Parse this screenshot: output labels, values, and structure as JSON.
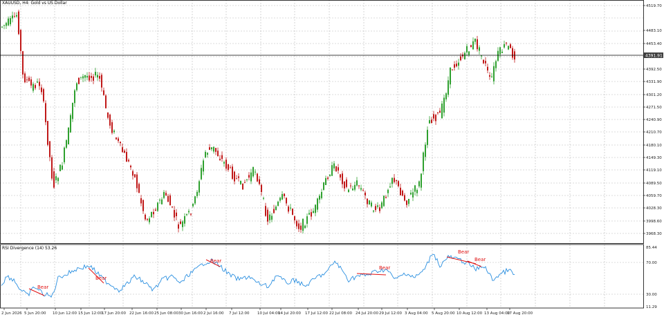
{
  "window": {
    "title": "XAUUSD, H4: Gold vs US Dollar",
    "indicator_title": "RSI Divergence (14) 53.26"
  },
  "price_axis": {
    "labels": [
      "4519.70",
      "4483.10",
      "4453.40",
      "4422.10",
      "4392.50",
      "4331.90",
      "4301.20",
      "4271.50",
      "4240.90",
      "4210.70",
      "4180.10",
      "4149.30",
      "4119.10",
      "4089.50",
      "4059.70",
      "4028.30",
      "3998.60",
      "3968.30"
    ],
    "current_price": "4391.91"
  },
  "rsi_axis": {
    "labels": [
      "85.44",
      "70.00",
      "30.00",
      "11.29"
    ]
  },
  "time_axis": {
    "labels": [
      "2 Jun 2026",
      "5 Jun 20:00",
      "10 Jun 12:00",
      "15 Jun 12:00",
      "17 Jun 20:00",
      "22 Jun 16:00",
      "25 Jun 08:00",
      "30 Jun 16:00",
      "2 Jul 16:00",
      "7 Jul 12:00",
      "10 Jul 04:00",
      "14 Jul 20:00",
      "17 Jul 12:00",
      "22 Jul 08:00",
      "24 Jul 20:00",
      "29 Jul 12:00",
      "3 Aug 04:00",
      "5 Aug 20:00",
      "10 Aug 12:00",
      "13 Aug 04:00",
      "17 Aug 20:00"
    ]
  },
  "divergence_labels": [
    "Bear",
    "Bear",
    "Bear",
    "Bear",
    "Bear",
    "Bear"
  ],
  "colors": {
    "bull": "#2ea02e",
    "bear": "#c01818",
    "grid": "#b8b8b8",
    "rsi_line": "#2a8fe0",
    "divergence": "#e01010",
    "current_price_line": "#000000",
    "price_tag_bg": "#404040"
  },
  "chart_data": {
    "type": "candlestick",
    "series": [
      {
        "name": "XAUUSD"
      },
      {
        "name": "RSI Divergence (14)"
      }
    ]
  }
}
